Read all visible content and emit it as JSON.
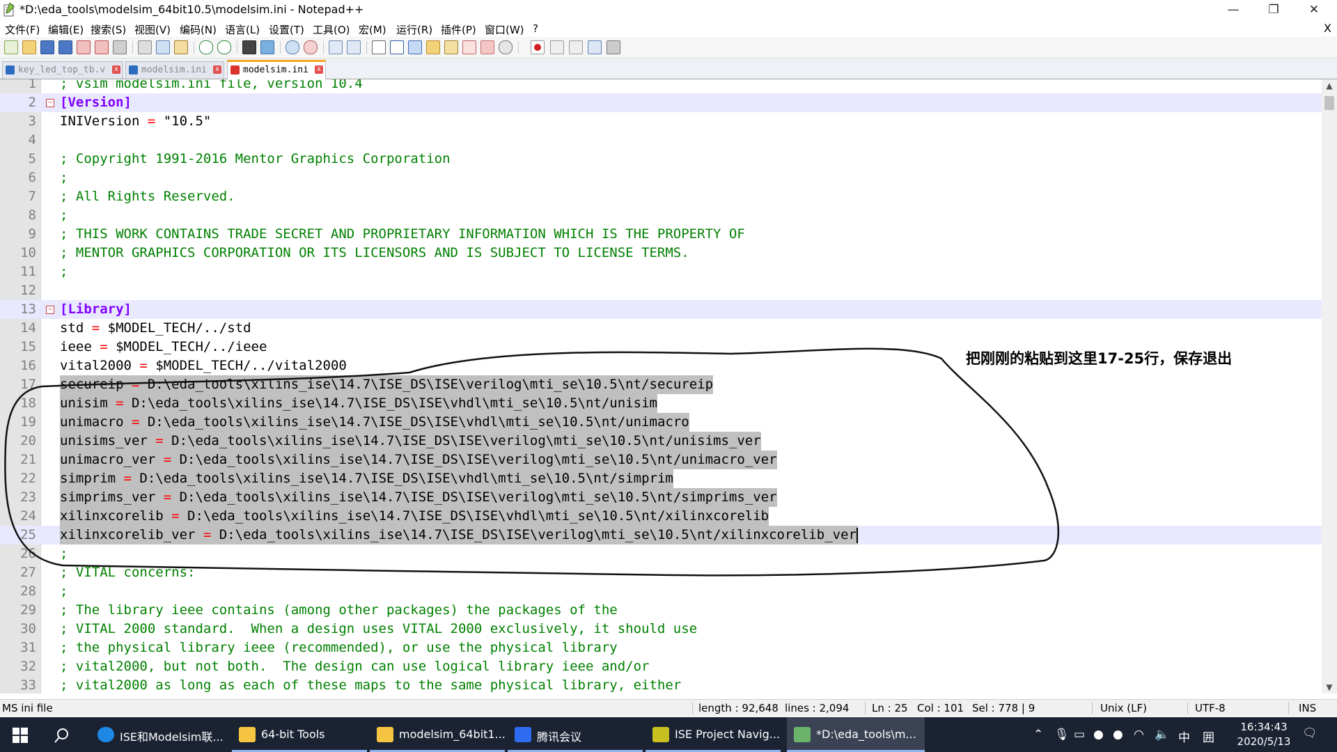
{
  "window": {
    "title": "*D:\\eda_tools\\modelsim_64bit10.5\\modelsim.ini - Notepad++",
    "minimize": "—",
    "maximize": "❐",
    "close": "✕"
  },
  "menu": {
    "items": [
      "文件(F)",
      "编辑(E)",
      "搜索(S)",
      "视图(V)",
      "编码(N)",
      "语言(L)",
      "设置(T)",
      "工具(O)",
      "宏(M)",
      "运行(R)",
      "插件(P)",
      "窗口(W)",
      "?"
    ],
    "close": "X"
  },
  "tabs": [
    {
      "label": "key_led_top_tb.v",
      "active": false
    },
    {
      "label": "modelsim.ini",
      "active": false
    },
    {
      "label": "modelsim.ini",
      "active": true
    }
  ],
  "editor": {
    "lines": [
      {
        "n": "1",
        "text": "; vsim modelsim.ini file, version 10.4"
      },
      {
        "n": "2",
        "text": "[Version]"
      },
      {
        "n": "3",
        "text": "INIVersion = \"10.5\""
      },
      {
        "n": "4",
        "text": ""
      },
      {
        "n": "5",
        "text": "; Copyright 1991-2016 Mentor Graphics Corporation"
      },
      {
        "n": "6",
        "text": ";"
      },
      {
        "n": "7",
        "text": "; All Rights Reserved."
      },
      {
        "n": "8",
        "text": ";"
      },
      {
        "n": "9",
        "text": "; THIS WORK CONTAINS TRADE SECRET AND PROPRIETARY INFORMATION WHICH IS THE PROPERTY OF"
      },
      {
        "n": "10",
        "text": "; MENTOR GRAPHICS CORPORATION OR ITS LICENSORS AND IS SUBJECT TO LICENSE TERMS."
      },
      {
        "n": "11",
        "text": ";"
      },
      {
        "n": "12",
        "text": ""
      },
      {
        "n": "13",
        "text": "[Library]"
      },
      {
        "n": "14",
        "text": "std = $MODEL_TECH/../std"
      },
      {
        "n": "15",
        "text": "ieee = $MODEL_TECH/../ieee"
      },
      {
        "n": "16",
        "text": "vital2000 = $MODEL_TECH/../vital2000"
      },
      {
        "n": "17",
        "text": "secureip = D:\\eda_tools\\xilins_ise\\14.7\\ISE_DS\\ISE\\verilog\\mti_se\\10.5\\nt/secureip"
      },
      {
        "n": "18",
        "text": "unisim = D:\\eda_tools\\xilins_ise\\14.7\\ISE_DS\\ISE\\vhdl\\mti_se\\10.5\\nt/unisim"
      },
      {
        "n": "19",
        "text": "unimacro = D:\\eda_tools\\xilins_ise\\14.7\\ISE_DS\\ISE\\vhdl\\mti_se\\10.5\\nt/unimacro"
      },
      {
        "n": "20",
        "text": "unisims_ver = D:\\eda_tools\\xilins_ise\\14.7\\ISE_DS\\ISE\\verilog\\mti_se\\10.5\\nt/unisims_ver"
      },
      {
        "n": "21",
        "text": "unimacro_ver = D:\\eda_tools\\xilins_ise\\14.7\\ISE_DS\\ISE\\verilog\\mti_se\\10.5\\nt/unimacro_ver"
      },
      {
        "n": "22",
        "text": "simprim = D:\\eda_tools\\xilins_ise\\14.7\\ISE_DS\\ISE\\vhdl\\mti_se\\10.5\\nt/simprim"
      },
      {
        "n": "23",
        "text": "simprims_ver = D:\\eda_tools\\xilins_ise\\14.7\\ISE_DS\\ISE\\verilog\\mti_se\\10.5\\nt/simprims_ver"
      },
      {
        "n": "24",
        "text": "xilinxcorelib = D:\\eda_tools\\xilins_ise\\14.7\\ISE_DS\\ISE\\vhdl\\mti_se\\10.5\\nt/xilinxcorelib"
      },
      {
        "n": "25",
        "text": "xilinxcorelib_ver = D:\\eda_tools\\xilins_ise\\14.7\\ISE_DS\\ISE\\verilog\\mti_se\\10.5\\nt/xilinxcorelib_ver"
      },
      {
        "n": "26",
        "text": ";"
      },
      {
        "n": "27",
        "text": "; VITAL concerns:"
      },
      {
        "n": "28",
        "text": ";"
      },
      {
        "n": "29",
        "text": "; The library ieee contains (among other packages) the packages of the"
      },
      {
        "n": "30",
        "text": "; VITAL 2000 standard.  When a design uses VITAL 2000 exclusively, it should use"
      },
      {
        "n": "31",
        "text": "; the physical library ieee (recommended), or use the physical library"
      },
      {
        "n": "32",
        "text": "; vital2000, but not both.  The design can use logical library ieee and/or"
      },
      {
        "n": "33",
        "text": "; vital2000 as long as each of these maps to the same physical library, either"
      }
    ],
    "selected_lines": [
      "17",
      "18",
      "19",
      "20",
      "21",
      "22",
      "23",
      "24",
      "25"
    ],
    "current_line": "25"
  },
  "annotation": {
    "text": "把刚刚的粘贴到这里17-25行，保存退出"
  },
  "status": {
    "filetype": "MS ini file",
    "length": "length : 92,648",
    "lines": "lines : 2,094",
    "ln": "Ln : 25",
    "col": "Col : 101",
    "sel": "Sel : 778 | 9",
    "eol": "Unix (LF)",
    "encoding": "UTF-8",
    "mode": "INS"
  },
  "taskbar": {
    "items": [
      {
        "label": "ISE和Modelsim联...",
        "color": "#1e88e5"
      },
      {
        "label": "64-bit Tools",
        "color": "#f5c542"
      },
      {
        "label": "modelsim_64bit1...",
        "color": "#f5c542"
      },
      {
        "label": "腾讯会议",
        "color": "#2f6bf0"
      },
      {
        "label": "ISE Project Navig...",
        "color": "#c8c020"
      },
      {
        "label": "*D:\\eda_tools\\m...",
        "color": "#6bb36b"
      }
    ],
    "tray_ime": "中",
    "tray_layout": "囲",
    "time": "16:34:43",
    "date": "2020/5/13"
  },
  "colors": {
    "comment": "#008000",
    "section": "#8000ff",
    "operator": "#ff0000",
    "selection": "#c0c0c0",
    "current_line": "#e8e8ff"
  }
}
